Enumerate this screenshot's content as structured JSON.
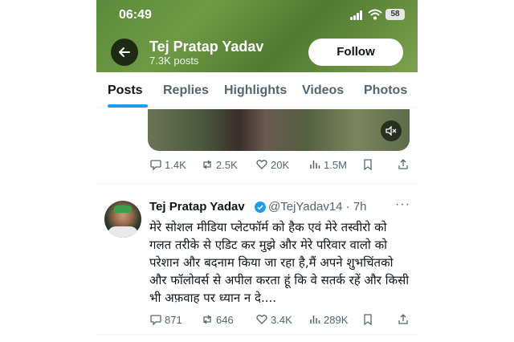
{
  "status_bar": {
    "time": "06:49",
    "battery": "58"
  },
  "header": {
    "name": "Tej Pratap Yadav",
    "posts_count": "7.3K posts",
    "follow_label": "Follow"
  },
  "tabs": [
    {
      "label": "Posts",
      "active": true
    },
    {
      "label": "Replies",
      "active": false
    },
    {
      "label": "Highlights",
      "active": false
    },
    {
      "label": "Videos",
      "active": false
    },
    {
      "label": "Photos",
      "active": false
    }
  ],
  "post1": {
    "replies": "1.4K",
    "reposts": "2.5K",
    "likes": "20K",
    "views": "1.5M"
  },
  "post2": {
    "author": "Tej Pratap Yadav",
    "handle": "@TejYadav14 · 7h",
    "text": "मेरे सोशल मीडिया प्लेटफॉर्म को हैक एवं मेरे तस्वीरो को गलत तरीके से एडिट कर मुझे और मेरे परिवार वालो को परेशान और बदनाम किया जा रहा है,मैं अपने शुभचिंतको और फॉलोवर्स से अपील करता हूं कि वे सतर्क रहें और किसी भी अफ़वाह पर ध्यान न दे....",
    "replies": "871",
    "reposts": "646",
    "likes": "3.4K",
    "views": "289K"
  },
  "colors": {
    "accent": "#1d9bf0",
    "muted": "#536471",
    "header_green": "#5a8a3a"
  }
}
